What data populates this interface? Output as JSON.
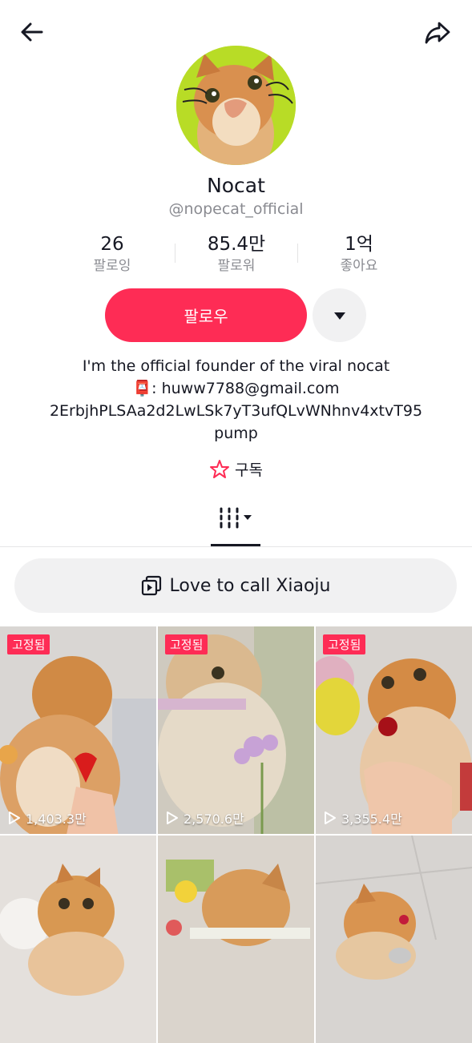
{
  "profile": {
    "name": "Nocat",
    "handle": "@nopecat_official"
  },
  "stats": [
    {
      "value": "26",
      "label": "팔로잉"
    },
    {
      "value": "85.4만",
      "label": "팔로워"
    },
    {
      "value": "1억",
      "label": "좋아요"
    }
  ],
  "actions": {
    "follow_label": "팔로우"
  },
  "bio": {
    "line1": "I'm the official founder of the viral nocat",
    "line2_emoji": "📮",
    "line2": ": huww7788@gmail.com",
    "line3": "2ErbjhPLSAa2d2LwLSk7yT3ufQLvWNhnv4xtvT95",
    "line4": "pump"
  },
  "subscribe_label": "구독",
  "playlist_label": "Love to call Xiaoju",
  "videos": [
    {
      "pinned": "고정됨",
      "views": "1,403.3만"
    },
    {
      "pinned": "고정됨",
      "views": "2,570.6만"
    },
    {
      "pinned": "고정됨",
      "views": "3,355.4만"
    },
    {
      "pinned": "",
      "views": ""
    },
    {
      "pinned": "",
      "views": ""
    },
    {
      "pinned": "",
      "views": ""
    }
  ],
  "colors": {
    "accent": "#fe2c55",
    "avatar_bg": "#b8dc26"
  }
}
